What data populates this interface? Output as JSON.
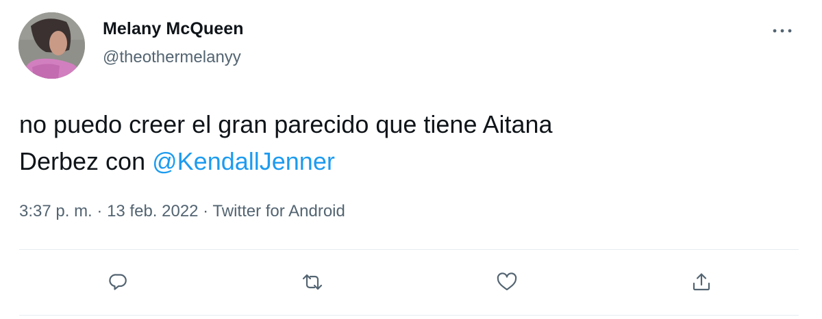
{
  "tweet": {
    "author": {
      "display_name": "Melany McQueen",
      "handle": "@theothermelanyy"
    },
    "text": {
      "line1": "no puedo creer el gran parecido que tiene Aitana",
      "line2_prefix": "Derbez con ",
      "mention": "@KendallJenner"
    },
    "meta": {
      "time": "3:37 p. m.",
      "separator": " · ",
      "date": "13 feb. 2022",
      "source": "Twitter for Android"
    },
    "icons": {
      "more": "more-horizontal-icon",
      "reply": "reply-icon",
      "retweet": "retweet-icon",
      "like": "like-icon",
      "share": "share-icon"
    },
    "colors": {
      "text": "#0f1419",
      "secondary": "#536471",
      "link": "#1d9bf0",
      "divider": "#e6ecf0"
    }
  }
}
